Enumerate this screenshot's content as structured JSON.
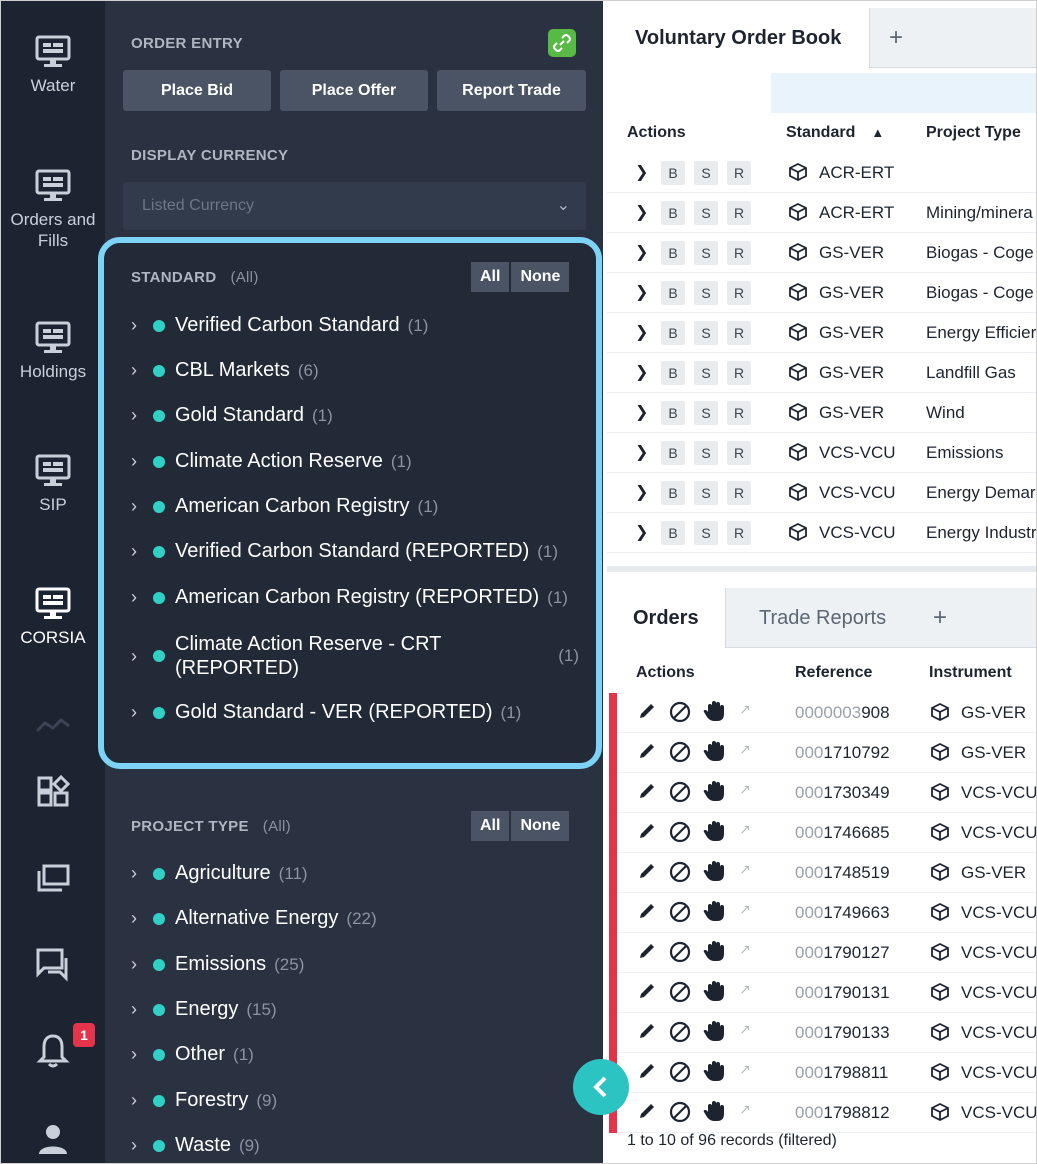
{
  "rail": {
    "items": [
      {
        "label": "Water",
        "icon": "monitor-icon"
      },
      {
        "label": "Orders and Fills",
        "icon": "monitor-icon"
      },
      {
        "label": "Holdings",
        "icon": "monitor-icon"
      },
      {
        "label": "SIP",
        "icon": "monitor-icon"
      },
      {
        "label": "CORSIA",
        "icon": "monitor-icon"
      }
    ],
    "notification_count": "1"
  },
  "order_entry": {
    "title": "ORDER ENTRY",
    "place_bid": "Place Bid",
    "place_offer": "Place Offer",
    "report_trade": "Report Trade"
  },
  "display_currency": {
    "title": "DISPLAY CURRENCY",
    "placeholder": "Listed Currency"
  },
  "standard_filter": {
    "title": "STANDARD",
    "scope": "(All)",
    "all_label": "All",
    "none_label": "None",
    "items": [
      {
        "label": "Verified Carbon Standard",
        "count": "(1)"
      },
      {
        "label": "CBL Markets",
        "count": "(6)"
      },
      {
        "label": "Gold Standard",
        "count": "(1)"
      },
      {
        "label": "Climate Action Reserve",
        "count": "(1)"
      },
      {
        "label": "American Carbon Registry",
        "count": "(1)"
      },
      {
        "label": "Verified Carbon Standard (REPORTED)",
        "count": "(1)"
      },
      {
        "label": "American Carbon Registry (REPORTED)",
        "count": "(1)"
      },
      {
        "label": "Climate Action Reserve - CRT (REPORTED)",
        "count": "(1)"
      },
      {
        "label": "Gold Standard - VER (REPORTED)",
        "count": "(1)"
      }
    ]
  },
  "project_type_filter": {
    "title": "PROJECT TYPE",
    "scope": "(All)",
    "all_label": "All",
    "none_label": "None",
    "items": [
      {
        "label": "Agriculture",
        "count": "(11)"
      },
      {
        "label": "Alternative Energy",
        "count": "(22)"
      },
      {
        "label": "Emissions",
        "count": "(25)"
      },
      {
        "label": "Energy",
        "count": "(15)"
      },
      {
        "label": "Other",
        "count": "(1)"
      },
      {
        "label": "Forestry",
        "count": "(9)"
      },
      {
        "label": "Waste",
        "count": "(9)"
      }
    ]
  },
  "order_book": {
    "tab": "Voluntary Order Book",
    "add_tab": "+",
    "headers": {
      "actions": "Actions",
      "standard": "Standard",
      "project_type": "Project Type"
    },
    "action_labels": [
      "B",
      "S",
      "R"
    ],
    "rows": [
      {
        "standard": "ACR-ERT",
        "project_type": ""
      },
      {
        "standard": "ACR-ERT",
        "project_type": "Mining/minera"
      },
      {
        "standard": "GS-VER",
        "project_type": "Biogas - Coge"
      },
      {
        "standard": "GS-VER",
        "project_type": "Biogas - Coge"
      },
      {
        "standard": "GS-VER",
        "project_type": "Energy Efficier"
      },
      {
        "standard": "GS-VER",
        "project_type": "Landfill Gas"
      },
      {
        "standard": "GS-VER",
        "project_type": "Wind"
      },
      {
        "standard": "VCS-VCU",
        "project_type": "Emissions"
      },
      {
        "standard": "VCS-VCU",
        "project_type": "Energy Demar"
      },
      {
        "standard": "VCS-VCU",
        "project_type": "Energy Industr"
      }
    ]
  },
  "orders": {
    "tabs": [
      "Orders",
      "Trade Reports"
    ],
    "add_tab": "+",
    "headers": {
      "actions": "Actions",
      "reference": "Reference",
      "instrument": "Instrument"
    },
    "rows": [
      {
        "ref_prefix": "0000003",
        "ref_suffix": "908",
        "instrument": "GS-VER"
      },
      {
        "ref_prefix": "000",
        "ref_suffix": "1710792",
        "instrument": "GS-VER"
      },
      {
        "ref_prefix": "000",
        "ref_suffix": "1730349",
        "instrument": "VCS-VCU"
      },
      {
        "ref_prefix": "000",
        "ref_suffix": "1746685",
        "instrument": "VCS-VCU"
      },
      {
        "ref_prefix": "000",
        "ref_suffix": "1748519",
        "instrument": "GS-VER"
      },
      {
        "ref_prefix": "000",
        "ref_suffix": "1749663",
        "instrument": "VCS-VCU"
      },
      {
        "ref_prefix": "000",
        "ref_suffix": "1790127",
        "instrument": "VCS-VCU"
      },
      {
        "ref_prefix": "000",
        "ref_suffix": "1790131",
        "instrument": "VCS-VCU"
      },
      {
        "ref_prefix": "000",
        "ref_suffix": "1790133",
        "instrument": "VCS-VCU"
      },
      {
        "ref_prefix": "000",
        "ref_suffix": "1798811",
        "instrument": "VCS-VCU"
      },
      {
        "ref_prefix": "000",
        "ref_suffix": "1798812",
        "instrument": "VCS-VCU"
      }
    ],
    "footer": "1 to 10 of 96 records (filtered)"
  },
  "colors": {
    "rail_bg": "#1c2431",
    "panel_bg": "#2a3241",
    "highlight_border": "#7dd3f5",
    "dot": "#31d0c6",
    "link_green": "#58b947",
    "status_red": "#e3344b"
  }
}
